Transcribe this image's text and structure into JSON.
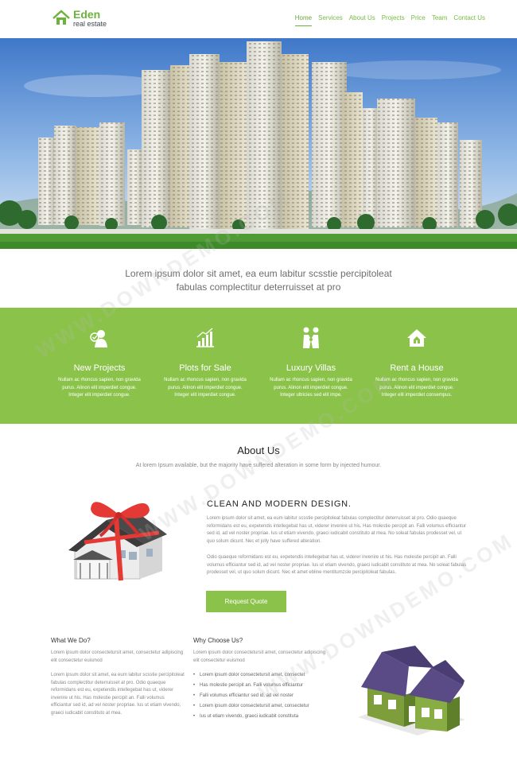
{
  "brand": {
    "name": "Eden",
    "subtitle": "real estate"
  },
  "nav": [
    {
      "label": "Home",
      "active": true
    },
    {
      "label": "Services"
    },
    {
      "label": "About Us"
    },
    {
      "label": "Projects"
    },
    {
      "label": "Price"
    },
    {
      "label": "Team"
    },
    {
      "label": "Contact Us"
    }
  ],
  "tagline": {
    "line1": "Lorem ipsum dolor sit amet, ea eum labitur scsstie percipitoleat",
    "line2": "fabulas complectitur deterruisset at pro"
  },
  "services": [
    {
      "icon": "agent-icon",
      "title": "New Projects",
      "text": "Nullam ac rhoncus sapien, non gravida purus. Alinon elit imperdiet congue. Integer elit imperdiet congue."
    },
    {
      "icon": "growth-chart-icon",
      "title": "Plots for Sale",
      "text": "Nullam ac rhoncus sapien, non gravida purus. Alinon elit imperdiet congue. Integer elit imperdiet congue."
    },
    {
      "icon": "handshake-icon",
      "title": "Luxury Villas",
      "text": "Nullam ac rhoncus sapien, non gravida purus. Alinon elit imperdiet congue. Integer ultricies sed elit impe."
    },
    {
      "icon": "house-icon",
      "title": "Rent a House",
      "text": "Nullam ac rhoncus sapien, non gravida purus. Alinon elit imperdiet congue. Integer elit imperdiet consempus."
    }
  ],
  "about": {
    "title": "About Us",
    "subtitle": "At lorem Ipsum available, but the majority have suffered alteration in some form by injected humour.",
    "heading": "CLEAN AND MODERN DESIGN.",
    "para1": "Lorem ipsum dolor sit amet, ea eum labitur scsstie percipitoleat fabulas complectitur deterruisset at pro. Odio quaeque reformidans est eu, expetendis intellegebat has ut, viderer invenire ut his. Has molestie percipit an. Falli volumus efficiantur sed id, ad vel noster propriae. Ius ut etiam vivendo, graeci iudicabit constituto at mea. No soleat fabulas prodesset vel, ut quo solum dicunt. Nec et jolly have suffered alteration.",
    "para2": "Odio quaeque reformidans est eu, expetendis intellegebat has ut, viderer invenire ut his. Has molestie percipit an. Falli volumus efficiantur sed id, ad vel noster propriae. Ius ut etiam vivendo, graeci iudicabit constituto at mea. No soleat fabulas prodesset vel, ut quo solum dicunt. Nec et amet ebline mentitumzsle percipitoleat fabulas.",
    "button": "Request Quote"
  },
  "what_we_do": {
    "title": "What We Do?",
    "intro": "Lorem ipsum dolor consectetursit amet, consectetur adipiscing elit consectetur euismod",
    "body": "Lorem ipsum dolor sit amet, ea eum labitur scsstie percipitoleat fabulas complectitur deterruisset at pro. Odio quaeque reformidans est eu, expetendis intellegebat has ut, viderer invenire ut his. Has molestie percipit an. Falli volumus efficiantur sed id, ad vel noster propriae. Ius ut etiam vivendo, graeci iudicabit constituto at mea."
  },
  "why_choose": {
    "title": "Why Choose Us?",
    "intro": "Lorem ipsum dolor consectetursit amet, consectetur adipiscing elit consectetur euismod",
    "items": [
      "Lorem ipsum dolor consectetursit amet, consectet",
      "Has molestie percipit an. Falli volumus efficiantur",
      "Falli volumus efficiantur sed id, ad vel noster",
      "Lorem ipsum dolor consectetursit amet, consectetur",
      "Ius ut etiam vivendo, graeci iudicabit constituta"
    ]
  },
  "watermark": "WWW.DOWNDEMO.COM",
  "colors": {
    "accent": "#8bc34a",
    "brand": "#6cb33e",
    "sky": "#5b8fd6"
  }
}
